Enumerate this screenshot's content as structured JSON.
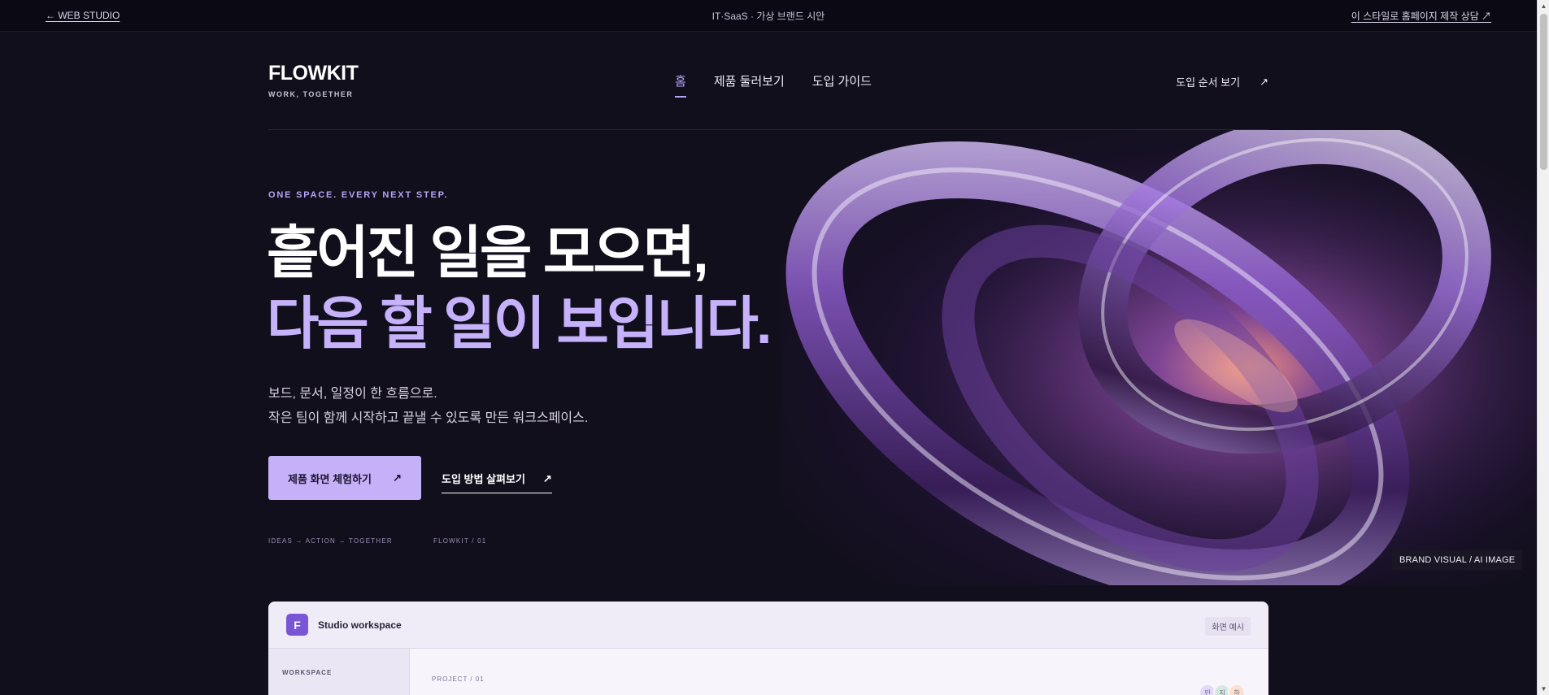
{
  "topbar": {
    "back_link": "← WEB STUDIO",
    "center_text": "IT·SaaS · 가상 브랜드 시안",
    "consult_link": "이 스타일로 홈페이지 제작 상담 ↗"
  },
  "header": {
    "logo_name": "FLOWKIT",
    "logo_tagline": "WORK, TOGETHER",
    "nav": [
      {
        "label": "홈",
        "active": true
      },
      {
        "label": "제품 둘러보기",
        "active": false
      },
      {
        "label": "도입 가이드",
        "active": false
      }
    ],
    "cta_label": "도입 순서 보기",
    "cta_icon": "↗"
  },
  "hero": {
    "eyebrow": "ONE SPACE. EVERY NEXT STEP.",
    "headline_line1": "흩어진 일을 모으면,",
    "headline_line2": "다음 할 일이 보입니다.",
    "lead_line1": "보드, 문서, 일정이 한 흐름으로.",
    "lead_line2": "작은 팀이 함께 시작하고 끝낼 수 있도록 만든 워크스페이스.",
    "primary_button": "제품 화면 체험하기",
    "primary_icon": "↗",
    "secondary_button": "도입 방법 살펴보기",
    "secondary_icon": "↗",
    "tagline_left": "IDEAS → ACTION → TOGETHER",
    "tagline_right": "FLOWKIT / 01",
    "visual_badge": "BRAND VISUAL / AI IMAGE"
  },
  "workspace_card": {
    "logo_letter": "F",
    "title": "Studio workspace",
    "pill": "화면 예시",
    "sidebar_label": "WORKSPACE",
    "project_label": "PROJECT / 01",
    "avatars": [
      "민",
      "지",
      "하"
    ]
  },
  "colors": {
    "background": "#120f1c",
    "accent": "#b8a4f6",
    "primary_button": "#c4b1f8"
  }
}
